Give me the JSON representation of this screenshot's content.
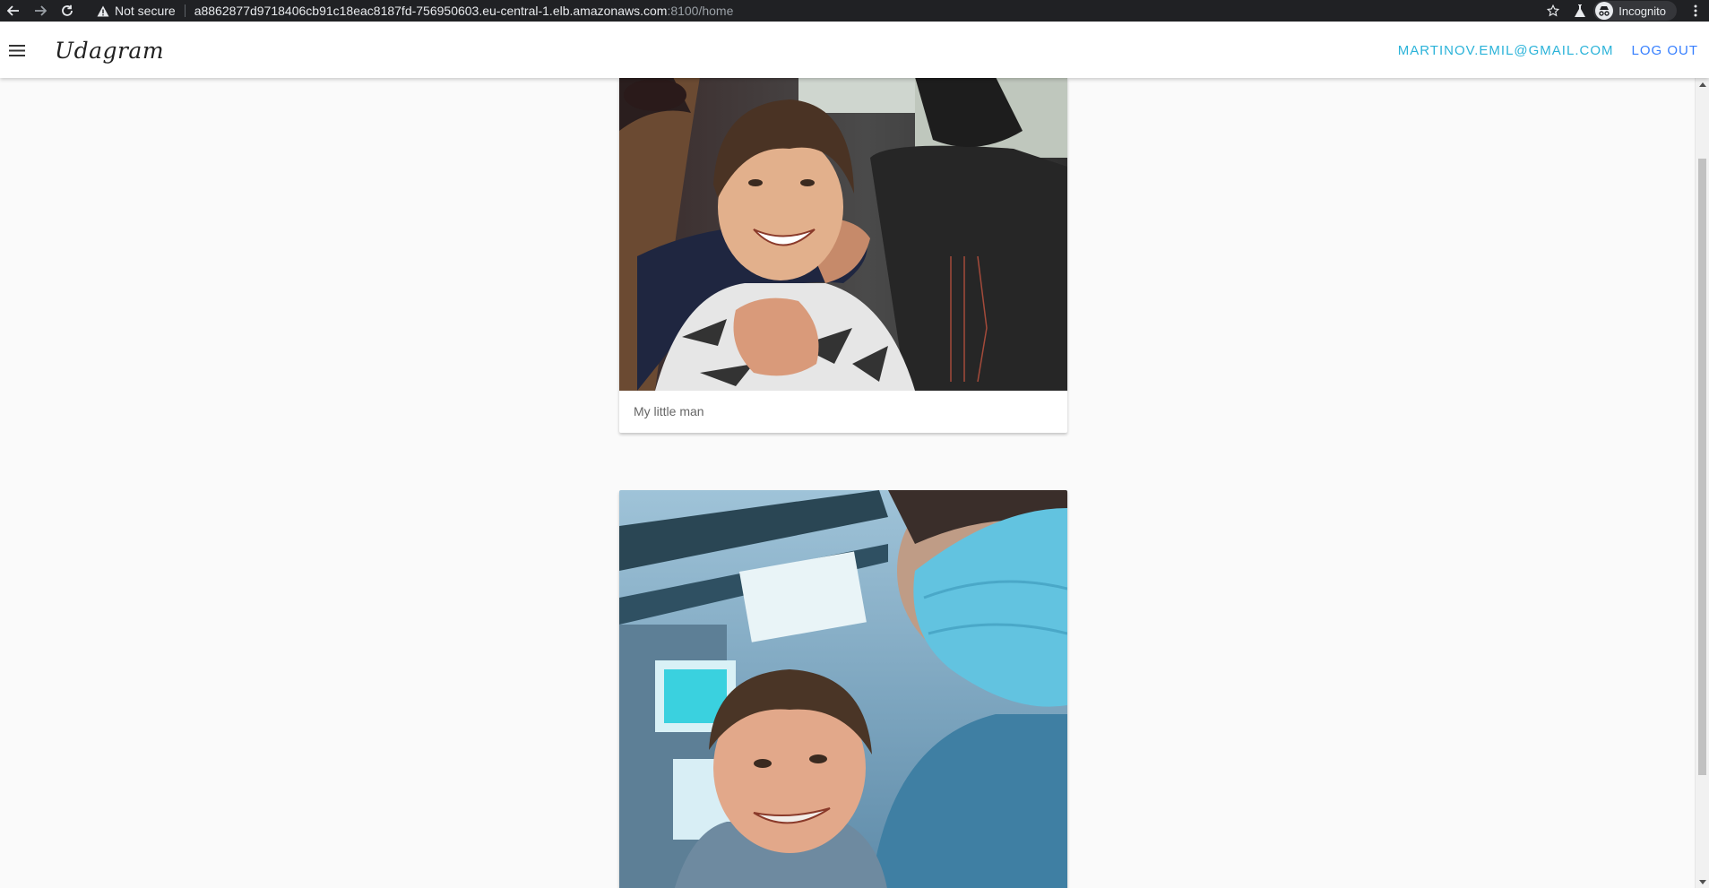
{
  "browser": {
    "security_label": "Not secure",
    "url_host": "a8862877d9718406cb91c18eac8187fd-756950603.eu-central-1.elb.amazonaws.com",
    "url_rest": ":8100/home",
    "incognito_label": "Incognito"
  },
  "toolbar": {
    "brand": "Udagram",
    "user_email": "MARTINOV.EMIL@GMAIL.COM",
    "logout_label": "LOG OUT",
    "accent_color": "#2bb3d9",
    "logout_color": "#3880ff"
  },
  "feed": {
    "items": [
      {
        "caption": "My little man",
        "image": "photo-boy-in-car-seat"
      },
      {
        "caption": "",
        "image": "photo-boy-and-man-with-mask-on-bus"
      }
    ]
  }
}
